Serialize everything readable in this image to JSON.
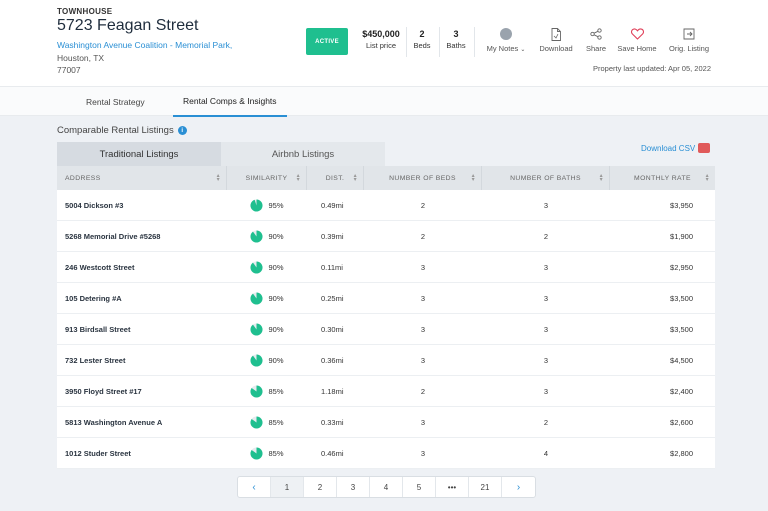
{
  "property": {
    "type": "TOWNHOUSE",
    "address": "5723 Feagan Street",
    "community": "Washington Avenue Coalition - Memorial Park,",
    "city": "Houston, TX",
    "zip": "77007",
    "status": "ACTIVE",
    "status_color": "#1fbf8f"
  },
  "stats": [
    {
      "value": "$450,000",
      "label": "List price"
    },
    {
      "value": "2",
      "label": "Beds"
    },
    {
      "value": "3",
      "label": "Baths"
    }
  ],
  "actions": [
    {
      "label": "My Notes",
      "icon": "notes-icon"
    },
    {
      "label": "Download",
      "icon": "document-icon"
    },
    {
      "label": "Share",
      "icon": "share-icon"
    },
    {
      "label": "Save Home",
      "icon": "heart-icon"
    },
    {
      "label": "Orig. Listing",
      "icon": "external-link-icon"
    }
  ],
  "updated": "Property last updated: Apr 05, 2022",
  "tabs": [
    {
      "label": "Rental Strategy",
      "active": false
    },
    {
      "label": "Rental Comps & Insights",
      "active": true
    }
  ],
  "section": {
    "title": "Comparable Rental Listings",
    "info_icon": "i"
  },
  "listing_tabs": [
    {
      "label": "Traditional Listings",
      "active": true
    },
    {
      "label": "Airbnb Listings",
      "active": false
    }
  ],
  "download_csv": "Download CSV",
  "table": {
    "headers": [
      "ADDRESS",
      "SIMILARITY",
      "DIST.",
      "NUMBER OF BEDS",
      "NUMBER OF BATHS",
      "MONTHLY RATE"
    ],
    "rows": [
      {
        "address": "5004 Dickson #3",
        "similarity": "95%",
        "sim_value": 0.95,
        "dist": "0.49mi",
        "beds": "2",
        "baths": "3",
        "rate": "$3,950"
      },
      {
        "address": "5268 Memorial Drive #5268",
        "similarity": "90%",
        "sim_value": 0.9,
        "dist": "0.39mi",
        "beds": "2",
        "baths": "2",
        "rate": "$1,900"
      },
      {
        "address": "246 Westcott Street",
        "similarity": "90%",
        "sim_value": 0.9,
        "dist": "0.11mi",
        "beds": "3",
        "baths": "3",
        "rate": "$2,950"
      },
      {
        "address": "105 Detering #A",
        "similarity": "90%",
        "sim_value": 0.9,
        "dist": "0.25mi",
        "beds": "3",
        "baths": "3",
        "rate": "$3,500"
      },
      {
        "address": "913 Birdsall Street",
        "similarity": "90%",
        "sim_value": 0.9,
        "dist": "0.30mi",
        "beds": "3",
        "baths": "3",
        "rate": "$3,500"
      },
      {
        "address": "732 Lester Street",
        "similarity": "90%",
        "sim_value": 0.9,
        "dist": "0.36mi",
        "beds": "3",
        "baths": "3",
        "rate": "$4,500"
      },
      {
        "address": "3950 Floyd Street #17",
        "similarity": "85%",
        "sim_value": 0.85,
        "dist": "1.18mi",
        "beds": "2",
        "baths": "3",
        "rate": "$2,400"
      },
      {
        "address": "5813 Washington Avenue A",
        "similarity": "85%",
        "sim_value": 0.85,
        "dist": "0.33mi",
        "beds": "3",
        "baths": "2",
        "rate": "$2,600"
      },
      {
        "address": "1012 Studer Street",
        "similarity": "85%",
        "sim_value": 0.85,
        "dist": "0.46mi",
        "beds": "3",
        "baths": "4",
        "rate": "$2,800"
      }
    ]
  },
  "pagination": {
    "prev": "‹",
    "pages": [
      "1",
      "2",
      "3",
      "4",
      "5",
      "•••",
      "21"
    ],
    "current": "1",
    "next": "›"
  },
  "colors": {
    "accent": "#2a8fd4",
    "pie": "#1fbf8f",
    "heart": "#e0415a"
  }
}
